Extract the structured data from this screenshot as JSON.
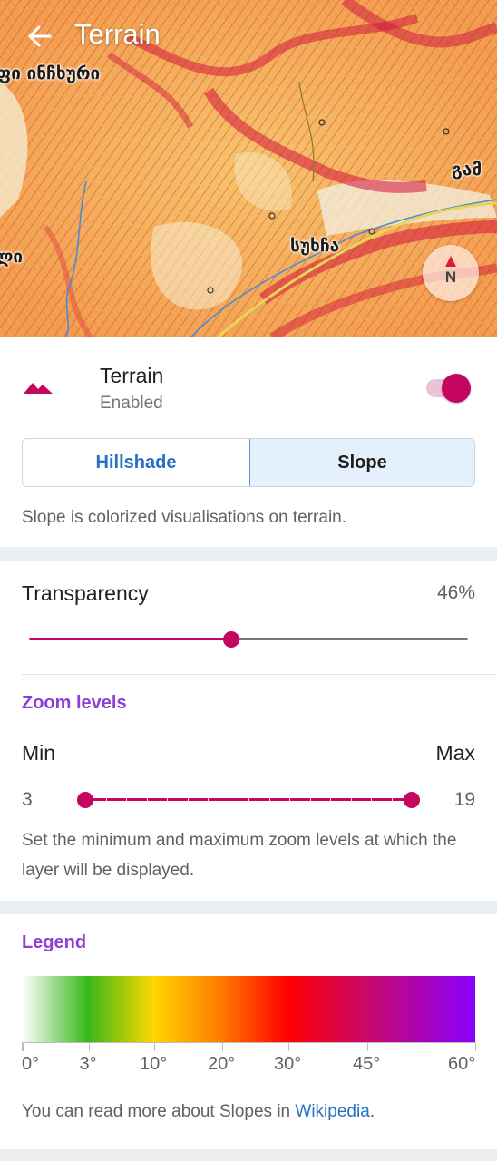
{
  "map": {
    "title": "Terrain",
    "labels": [
      "ფი ინჩხური",
      "გამ",
      "ლი",
      "სუხჩა"
    ],
    "compass_letter": "N"
  },
  "terrain": {
    "title": "Terrain",
    "status": "Enabled",
    "enabled": true,
    "modes": [
      "Hillshade",
      "Slope"
    ],
    "selected_mode": "Slope",
    "description": "Slope is colorized visualisations on terrain."
  },
  "transparency": {
    "label": "Transparency",
    "value_text": "46%",
    "value": 0.46
  },
  "zoom": {
    "title": "Zoom levels",
    "min_label": "Min",
    "max_label": "Max",
    "min": 3,
    "max": 19,
    "range_min": 1,
    "range_max": 22,
    "description": "Set the minimum and maximum zoom levels at which the layer will be displayed."
  },
  "legend": {
    "title": "Legend",
    "ticks": [
      "0°",
      "3°",
      "10°",
      "20°",
      "30°",
      "45°",
      "60°"
    ],
    "note_prefix": "You can read more about Slopes in ",
    "link_text": "Wikipedia",
    "note_suffix": ".",
    "colors": [
      "#ffffff",
      "#37b81a",
      "#ffd600",
      "#ff7a00",
      "#ff0000",
      "#c8086a",
      "#8a00ff"
    ]
  },
  "colors": {
    "accent": "#c4065f",
    "section_title": "#8e3fd6",
    "link": "#2771c4"
  }
}
